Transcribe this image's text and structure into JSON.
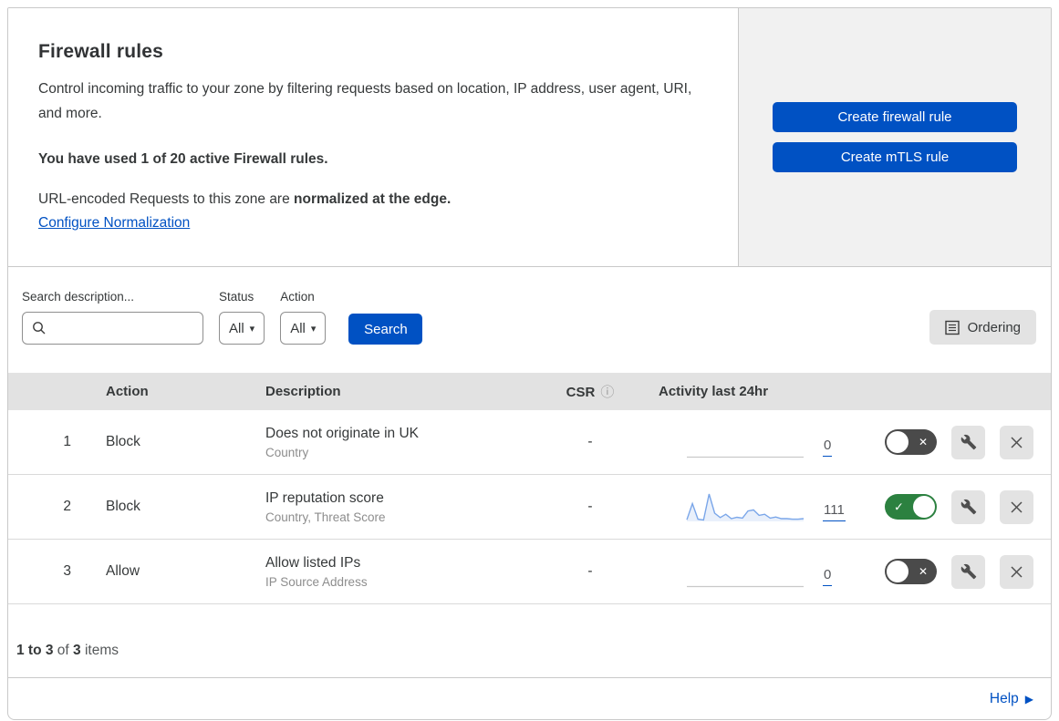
{
  "header": {
    "title": "Firewall rules",
    "description": "Control incoming traffic to your zone by filtering requests based on location, IP address, user agent, URI, and more.",
    "usage_bold": "You have used 1 of 20 active Firewall rules.",
    "normalization_prefix": "URL-encoded Requests to this zone are ",
    "normalization_bold": "normalized at the edge.",
    "normalization_link": "Configure Normalization"
  },
  "actions": {
    "create_firewall_rule": "Create firewall rule",
    "create_mtls_rule": "Create mTLS rule"
  },
  "filters": {
    "search_label": "Search description...",
    "search_value": "",
    "status_label": "Status",
    "status_value": "All",
    "action_label": "Action",
    "action_value": "All",
    "search_button": "Search",
    "ordering_button": "Ordering"
  },
  "table": {
    "columns": {
      "action": "Action",
      "description": "Description",
      "csr": "CSR",
      "csr_info_icon": "info-icon",
      "activity": "Activity last 24hr"
    },
    "rows": [
      {
        "priority": "1",
        "action": "Block",
        "description": "Does not originate in UK",
        "fields": "Country",
        "csr": "-",
        "activity_count": "0",
        "enabled": false,
        "sparkline": []
      },
      {
        "priority": "2",
        "action": "Block",
        "description": "IP reputation score",
        "fields": "Country, Threat Score",
        "csr": "-",
        "activity_count": "111",
        "enabled": true,
        "sparkline": [
          6,
          65,
          8,
          5,
          100,
          30,
          14,
          26,
          10,
          15,
          12,
          38,
          42,
          22,
          26,
          12,
          16,
          10,
          10,
          8,
          8,
          10
        ]
      },
      {
        "priority": "3",
        "action": "Allow",
        "description": "Allow listed IPs",
        "fields": "IP Source Address",
        "csr": "-",
        "activity_count": "0",
        "enabled": false,
        "sparkline": []
      }
    ]
  },
  "chart_data": {
    "type": "line",
    "title": "Activity last 24hr sparkline (rule 2)",
    "values": [
      6,
      65,
      8,
      5,
      100,
      30,
      14,
      26,
      10,
      15,
      12,
      38,
      42,
      22,
      26,
      12,
      16,
      10,
      10,
      8,
      8,
      10
    ],
    "ylim": [
      0,
      100
    ],
    "total_events_label": "111"
  },
  "footer": {
    "range": "1 to 3",
    "of": "of",
    "total": "3",
    "items": "items"
  },
  "help": {
    "label": "Help"
  },
  "colors": {
    "accent_blue": "#0051c3",
    "panel_gray": "#f1f1f1",
    "header_band_gray": "#e2e2e2",
    "toggle_on_green": "#2c8140",
    "toggle_off_gray": "#4a4a4a",
    "sparkline_blue": "#7aa6e9",
    "sparkline_fill": "#e9f0fb",
    "sparkline_flat_gray": "#c9c9c9"
  }
}
